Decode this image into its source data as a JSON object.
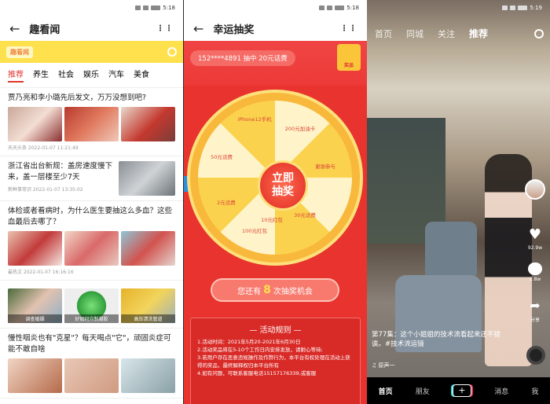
{
  "status": {
    "time_a": "5:18",
    "time_b": "5:18",
    "time_c": "5:19"
  },
  "p1": {
    "title": "趣看闻",
    "logo": "趣看闻",
    "tabs": [
      "推荐",
      "养生",
      "社会",
      "娱乐",
      "汽车",
      "美食"
    ],
    "news": [
      {
        "title": "贾乃亮和李小璐先后发文，万万没想到吧?",
        "meta": "天天头条  2022-01-07 11:21:49"
      },
      {
        "title": "浙江省出台新规：盖房速度慢下来，盖一层楼至少7天",
        "meta": "新鲜事常识  2022-01-07 13:35:02"
      },
      {
        "title": "体检或者看病时，为什么医生要抽这么多血？这些血最后去哪了？",
        "meta": "最热文  2022-01-07 16:16:16",
        "captions": []
      },
      {
        "title": "",
        "meta": "",
        "captions": [
          "调查婚姻",
          "好如何自制凝胶",
          "高压清洗管道"
        ]
      },
      {
        "title": "慢性咽炎也有\"克星\"？每天喝点\"它\"，顽固炎症可能不敢自啥",
        "meta": ""
      }
    ]
  },
  "p2": {
    "title": "幸运抽奖",
    "winner": "152****4891  抽中  20元话费",
    "gift_label": "奖品",
    "slots": [
      "iPhone12手机",
      "200元加油卡",
      "30元话费",
      "谢谢参与",
      "50元话费",
      "2元话费",
      "10元红包",
      "100元红包"
    ],
    "center": [
      "立即",
      "抽奖"
    ],
    "chances_pre": "您还有",
    "chances_num": "8",
    "chances_post": "次抽奖机会",
    "rules_title": "—  活动规则  —",
    "rules": [
      "1.活动时间：2021年5月20-2021年6月30日",
      "2.活动奖品将在5-10个工作日内安排发放，请耐心等待;",
      "3.若用户存在恶意违规操作及作弊行为，本平台有权处理在活动上获得的奖品，最终解释权归本平台所有",
      "4.如有问题，可联系客服电话15157176339,或客服"
    ]
  },
  "p3": {
    "nav": [
      "首页",
      "同城",
      "关注",
      "推荐"
    ],
    "rail": {
      "likes": "92.9w",
      "comments": "1.8w",
      "share": "分享"
    },
    "caption": "第77集：这个小姐姐的技术流看起来还不错诶。#技术流运镜",
    "music": "♫  原声一",
    "bottom": [
      "首页",
      "朋友",
      "+",
      "消息",
      "我"
    ]
  }
}
